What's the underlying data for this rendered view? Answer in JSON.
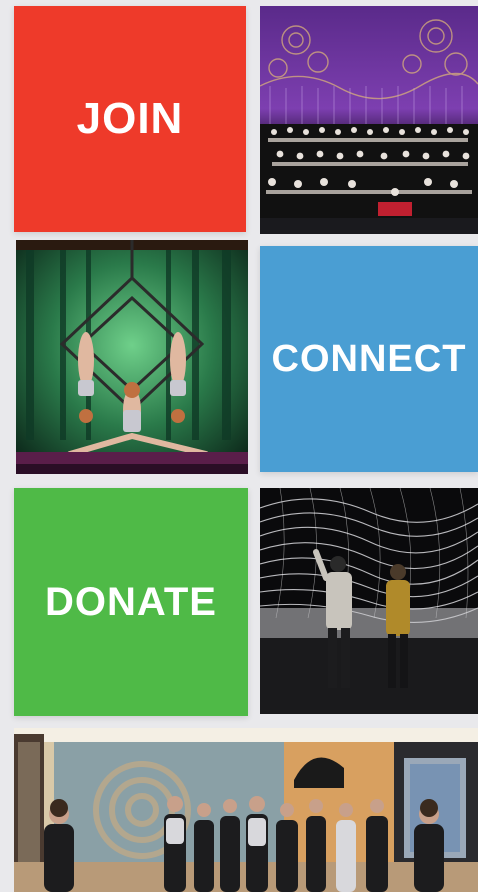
{
  "tiles": {
    "join": {
      "label": "JOIN",
      "color": "#ee3a2a"
    },
    "connect": {
      "label": "CONNECT",
      "color": "#4a9ed3"
    },
    "donate": {
      "label": "DONATE",
      "color": "#4fba47"
    }
  },
  "colors": {
    "background": "#e9e9ec"
  }
}
